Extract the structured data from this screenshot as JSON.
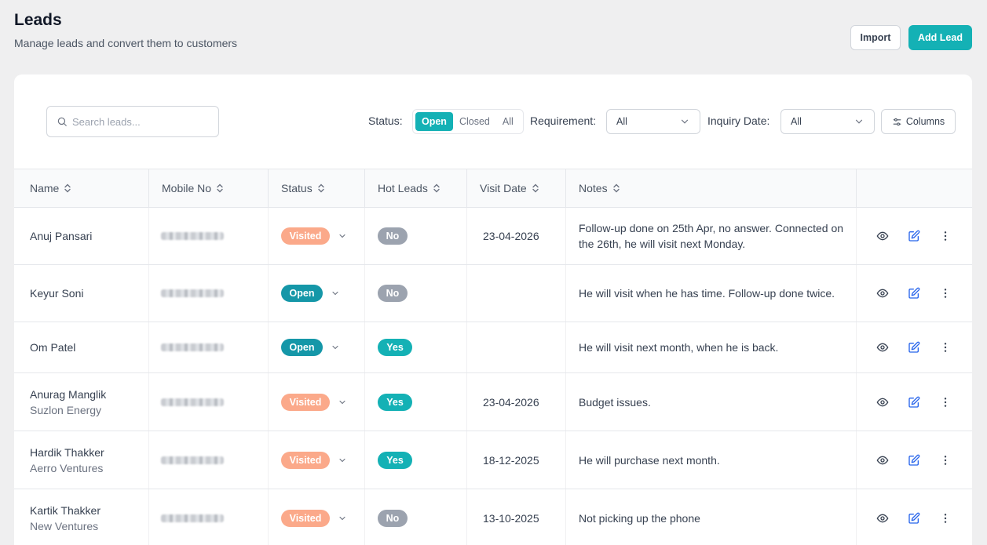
{
  "header": {
    "title": "Leads",
    "subtitle": "Manage leads and convert them to customers",
    "import_label": "Import",
    "add_label": "Add Lead"
  },
  "filters": {
    "search_placeholder": "Search leads...",
    "status_label": "Status:",
    "status_options": [
      "Open",
      "Closed",
      "All"
    ],
    "status_selected": "Open",
    "requirement_label": "Requirement:",
    "requirement_value": "All",
    "inquiry_label": "Inquiry Date:",
    "inquiry_value": "All",
    "columns_label": "Columns"
  },
  "table": {
    "columns": [
      "Name",
      "Mobile No",
      "Status",
      "Hot Leads",
      "Visit Date",
      "Notes"
    ],
    "rows": [
      {
        "name": "Anuj Pansari",
        "company": "",
        "status": "Visited",
        "hot": "No",
        "visit_date": "23-04-2026",
        "notes": "Follow-up done on 25th Apr, no answer. Connected on the 26th, he will visit next Monday."
      },
      {
        "name": "Keyur Soni",
        "company": "",
        "status": "Open",
        "hot": "No",
        "visit_date": "",
        "notes": "He will visit when he has time. Follow-up done twice."
      },
      {
        "name": "Om Patel",
        "company": "",
        "status": "Open",
        "hot": "Yes",
        "visit_date": "",
        "notes": "He will visit next month, when he is back."
      },
      {
        "name": "Anurag Manglik",
        "company": "Suzlon Energy",
        "status": "Visited",
        "hot": "Yes",
        "visit_date": "23-04-2026",
        "notes": "Budget issues."
      },
      {
        "name": "Hardik Thakker",
        "company": "Aerro Ventures",
        "status": "Visited",
        "hot": "Yes",
        "visit_date": "18-12-2025",
        "notes": "He will purchase next month."
      },
      {
        "name": "Kartik Thakker",
        "company": "New Ventures",
        "status": "Visited",
        "hot": "No",
        "visit_date": "13-10-2025",
        "notes": "Not picking up the phone"
      }
    ]
  },
  "colors": {
    "accent": "#14b1b5",
    "visited": "#fba98a",
    "open": "#1597a8",
    "no": "#9ca3af"
  },
  "icons": {
    "search": "search-icon",
    "chevron": "chevron-down-icon",
    "sort": "sort-icon",
    "columns": "sliders-icon",
    "view": "eye-icon",
    "edit": "edit-icon",
    "more": "more-vertical-icon"
  }
}
